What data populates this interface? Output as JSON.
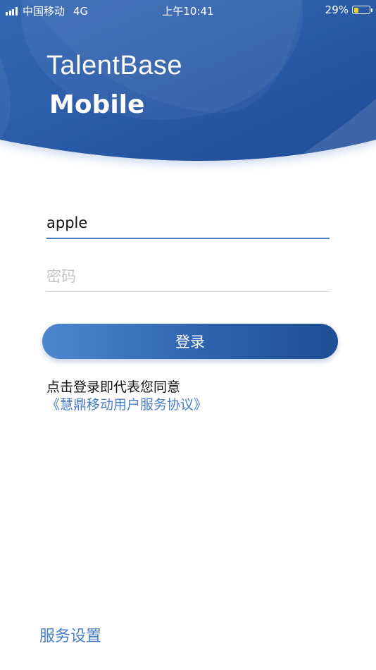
{
  "status_bar": {
    "carrier": "中国移动",
    "network": "4G",
    "time": "上午10:41",
    "battery_percent": "29%",
    "battery_level": 0.29,
    "battery_color": "#f2d027"
  },
  "brand": {
    "title": "TalentBase",
    "subtitle": "Mobile"
  },
  "form": {
    "username_value": "apple",
    "password_placeholder": "密码",
    "login_label": "登录"
  },
  "agreement": {
    "prefix": "点击登录即代表您同意",
    "link_text": "《慧鼎移动用户服务协议》"
  },
  "footer": {
    "service_settings": "服务设置"
  },
  "colors": {
    "brand_blue": "#2a5aa6",
    "accent_blue": "#4a7ec8"
  },
  "icons": [
    "signal-icon",
    "battery-icon"
  ]
}
